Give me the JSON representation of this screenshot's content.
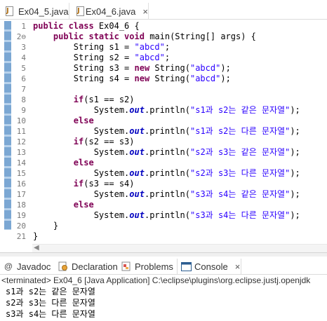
{
  "editor_tabs": [
    {
      "label": "Ex04_5.java",
      "active": false
    },
    {
      "label": "Ex04_6.java",
      "active": true,
      "close": "×"
    }
  ],
  "code_lines": [
    {
      "n": "1",
      "tokens": [
        [
          "kw",
          "public class "
        ],
        [
          "pl",
          "Ex04_6 {"
        ]
      ]
    },
    {
      "n": "2⊖",
      "fold": true,
      "tokens": [
        [
          "pl",
          "    "
        ],
        [
          "kw",
          "public static void "
        ],
        [
          "pl",
          "main(String[] args) {"
        ]
      ]
    },
    {
      "n": "3",
      "tokens": [
        [
          "pl",
          "        String s1 = "
        ],
        [
          "str",
          "\"abcd\""
        ],
        [
          "pl",
          ";"
        ]
      ]
    },
    {
      "n": "4",
      "tokens": [
        [
          "pl",
          "        String s2 = "
        ],
        [
          "str",
          "\"abcd\""
        ],
        [
          "pl",
          ";"
        ]
      ]
    },
    {
      "n": "5",
      "tokens": [
        [
          "pl",
          "        String s3 = "
        ],
        [
          "kw",
          "new "
        ],
        [
          "pl",
          "String("
        ],
        [
          "str",
          "\"abcd\""
        ],
        [
          "pl",
          ");"
        ]
      ]
    },
    {
      "n": "6",
      "tokens": [
        [
          "pl",
          "        String s4 = "
        ],
        [
          "kw",
          "new "
        ],
        [
          "pl",
          "String("
        ],
        [
          "str",
          "\"abcd\""
        ],
        [
          "pl",
          ");"
        ]
      ]
    },
    {
      "n": "7",
      "tokens": []
    },
    {
      "n": "8",
      "tokens": [
        [
          "pl",
          "        "
        ],
        [
          "kw",
          "if"
        ],
        [
          "pl",
          "(s1 == s2)"
        ]
      ]
    },
    {
      "n": "9",
      "tokens": [
        [
          "pl",
          "            System."
        ],
        [
          "it",
          "out"
        ],
        [
          "pl",
          ".println("
        ],
        [
          "str",
          "\"s1과 s2는 같은 문자열\""
        ],
        [
          "pl",
          ");"
        ]
      ]
    },
    {
      "n": "10",
      "tokens": [
        [
          "pl",
          "        "
        ],
        [
          "kw",
          "else"
        ]
      ]
    },
    {
      "n": "11",
      "tokens": [
        [
          "pl",
          "            System."
        ],
        [
          "it",
          "out"
        ],
        [
          "pl",
          ".println("
        ],
        [
          "str",
          "\"s1과 s2는 다른 문자열\""
        ],
        [
          "pl",
          ");"
        ]
      ]
    },
    {
      "n": "12",
      "tokens": [
        [
          "pl",
          "        "
        ],
        [
          "kw",
          "if"
        ],
        [
          "pl",
          "(s2 == s3)"
        ]
      ]
    },
    {
      "n": "13",
      "tokens": [
        [
          "pl",
          "            System."
        ],
        [
          "it",
          "out"
        ],
        [
          "pl",
          ".println("
        ],
        [
          "str",
          "\"s2과 s3는 같은 문자열\""
        ],
        [
          "pl",
          ");"
        ]
      ]
    },
    {
      "n": "14",
      "tokens": [
        [
          "pl",
          "        "
        ],
        [
          "kw",
          "else"
        ]
      ]
    },
    {
      "n": "15",
      "tokens": [
        [
          "pl",
          "            System."
        ],
        [
          "it",
          "out"
        ],
        [
          "pl",
          ".println("
        ],
        [
          "str",
          "\"s2과 s3는 다른 문자열\""
        ],
        [
          "pl",
          ");"
        ]
      ]
    },
    {
      "n": "16",
      "tokens": [
        [
          "pl",
          "        "
        ],
        [
          "kw",
          "if"
        ],
        [
          "pl",
          "(s3 == s4)"
        ]
      ]
    },
    {
      "n": "17",
      "tokens": [
        [
          "pl",
          "            System."
        ],
        [
          "it",
          "out"
        ],
        [
          "pl",
          ".println("
        ],
        [
          "str",
          "\"s3과 s4는 같은 문자열\""
        ],
        [
          "pl",
          ");"
        ]
      ]
    },
    {
      "n": "18",
      "tokens": [
        [
          "pl",
          "        "
        ],
        [
          "kw",
          "else"
        ]
      ]
    },
    {
      "n": "19",
      "tokens": [
        [
          "pl",
          "            System."
        ],
        [
          "it",
          "out"
        ],
        [
          "pl",
          ".println("
        ],
        [
          "str",
          "\"s3과 s4는 다른 문자열\""
        ],
        [
          "pl",
          ");"
        ]
      ]
    },
    {
      "n": "20",
      "tokens": [
        [
          "pl",
          "    }"
        ]
      ]
    },
    {
      "n": "21",
      "tokens": [
        [
          "pl",
          "}"
        ]
      ]
    }
  ],
  "panel_tabs": [
    {
      "label": "Javadoc",
      "icon": "@"
    },
    {
      "label": "Declaration",
      "icon": "declaration-icon"
    },
    {
      "label": "Problems",
      "icon": "problems-icon"
    },
    {
      "label": "Console",
      "icon": "console-icon",
      "active": true,
      "close": "×"
    }
  ],
  "console": {
    "header": "<terminated> Ex04_6 [Java Application] C:\\eclipse\\plugins\\org.eclipse.justj.openjdk",
    "output": [
      "s1과 s2는 같은 문자열",
      "s2과 s3는 다른 문자열",
      "s3과 s4는 다른 문자열"
    ]
  },
  "colors": {
    "keyword": "#7f0055",
    "string": "#2a00ff",
    "static_field": "#0000c0",
    "line_number": "#787878"
  }
}
